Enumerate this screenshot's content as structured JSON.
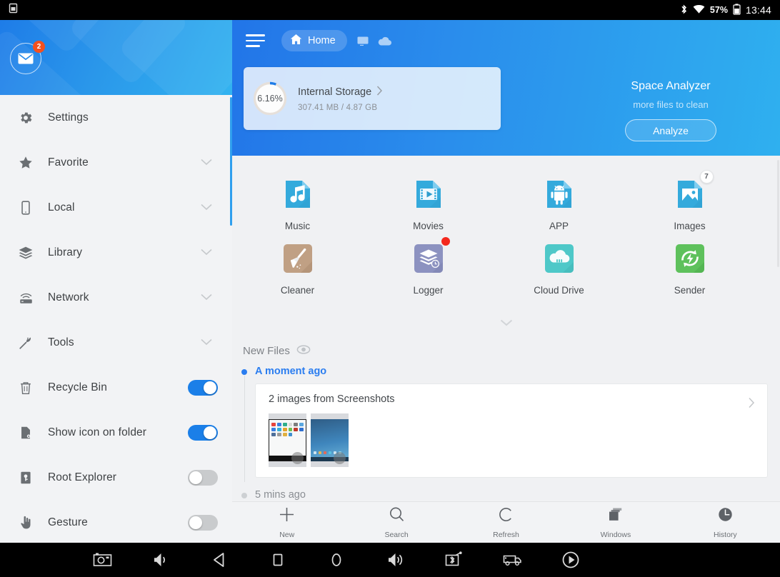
{
  "statusbar": {
    "battery_percent": "57%",
    "clock": "13:44",
    "icons": [
      "screenshot-icon",
      "bluetooth-icon",
      "wifi-icon",
      "battery-icon"
    ]
  },
  "sidebar": {
    "avatar": {
      "icon": "mail-icon",
      "badge": "2"
    },
    "items": [
      {
        "label": "Settings",
        "icon": "gear-icon",
        "control": "none"
      },
      {
        "label": "Favorite",
        "icon": "star-icon",
        "control": "chevron"
      },
      {
        "label": "Local",
        "icon": "phone-icon",
        "control": "chevron"
      },
      {
        "label": "Library",
        "icon": "layers-icon",
        "control": "chevron"
      },
      {
        "label": "Network",
        "icon": "router-icon",
        "control": "chevron"
      },
      {
        "label": "Tools",
        "icon": "wrench-icon",
        "control": "chevron"
      },
      {
        "label": "Recycle Bin",
        "icon": "trash-icon",
        "control": "toggle",
        "on": true
      },
      {
        "label": "Show icon on folder",
        "icon": "folder-icon",
        "control": "toggle",
        "on": true
      },
      {
        "label": "Root Explorer",
        "icon": "root-icon",
        "control": "toggle",
        "on": false
      },
      {
        "label": "Gesture",
        "icon": "hand-icon",
        "control": "toggle",
        "on": false
      }
    ]
  },
  "header": {
    "menu_icon": "hamburger-icon",
    "tab": {
      "label": "Home",
      "icon": "home-icon"
    },
    "mini_tabs": [
      "window-icon",
      "cloud-icon"
    ],
    "storage": {
      "percent": "6.16%",
      "name": "Internal Storage",
      "usage": "307.41 MB / 4.87 GB",
      "chevron": "chevron-right-icon"
    },
    "analyzer": {
      "title": "Space Analyzer",
      "subtitle": "more files to clean",
      "button": "Analyze"
    },
    "accent": "#2a8dec"
  },
  "grid": {
    "rows": [
      [
        {
          "label": "Music",
          "icon": "music-file-icon",
          "color": "#34aadc",
          "badge": null
        },
        {
          "label": "Movies",
          "icon": "video-file-icon",
          "color": "#34aadc",
          "badge": null
        },
        {
          "label": "APP",
          "icon": "android-file-icon",
          "color": "#34aadc",
          "badge": null
        },
        {
          "label": "Images",
          "icon": "image-file-icon",
          "color": "#34aadc",
          "badge": "7"
        }
      ],
      [
        {
          "label": "Cleaner",
          "icon": "broom-icon",
          "color": "#c0a084",
          "badge": null
        },
        {
          "label": "Logger",
          "icon": "log-stack-icon",
          "color": "#8c92c0",
          "badge": "dot"
        },
        {
          "label": "Cloud Drive",
          "icon": "cloud-drive-icon",
          "color": "#4ec8c8",
          "badge": null
        },
        {
          "label": "Sender",
          "icon": "sender-icon",
          "color": "#5ec15c",
          "badge": null
        }
      ]
    ],
    "expand_icon": "chevron-down-icon"
  },
  "new_files": {
    "title": "New Files",
    "eye_icon": "eye-icon",
    "groups": [
      {
        "time": "A moment ago",
        "active": true,
        "card": {
          "title": "2 images from Screenshots",
          "chevron": "chevron-right-icon",
          "thumb_count": 2
        }
      },
      {
        "time": "5 mins ago",
        "active": false,
        "card": null
      }
    ]
  },
  "toolbar": {
    "items": [
      {
        "label": "New",
        "icon": "plus-icon"
      },
      {
        "label": "Search",
        "icon": "search-icon"
      },
      {
        "label": "Refresh",
        "icon": "refresh-icon"
      },
      {
        "label": "Windows",
        "icon": "windows-stack-icon"
      },
      {
        "label": "History",
        "icon": "clock-icon"
      }
    ]
  },
  "navbar": {
    "buttons": [
      "camera-icon",
      "volume-down-icon",
      "back-icon",
      "recents-icon",
      "power-icon",
      "volume-up-icon",
      "bluetooth-transfer-icon",
      "truck-icon",
      "play-icon"
    ]
  }
}
